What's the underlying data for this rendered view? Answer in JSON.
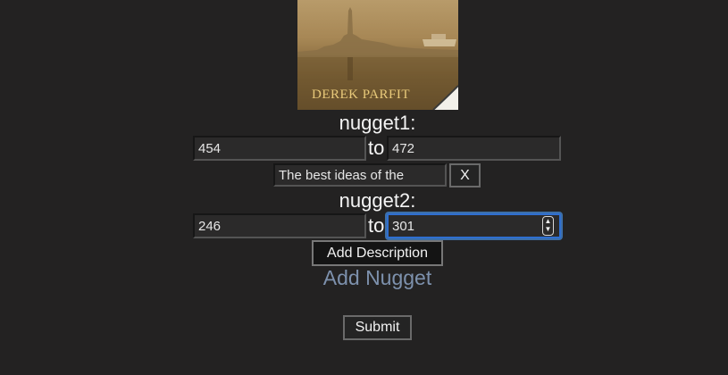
{
  "cover": {
    "author_text": "DEREK PARFIT"
  },
  "nuggets": [
    {
      "title": "nugget1:",
      "start": "454",
      "to_label": "to",
      "end": "472",
      "description": "The best ideas of the",
      "remove_label": "X"
    },
    {
      "title": "nugget2:",
      "start": "246",
      "to_label": "to",
      "end": "301",
      "add_description_label": "Add Description"
    }
  ],
  "add_nugget_label": "Add Nugget",
  "submit_label": "Submit",
  "colors": {
    "background": "#232222",
    "link": "#7d91ad",
    "focus": "#2f6fd1"
  }
}
